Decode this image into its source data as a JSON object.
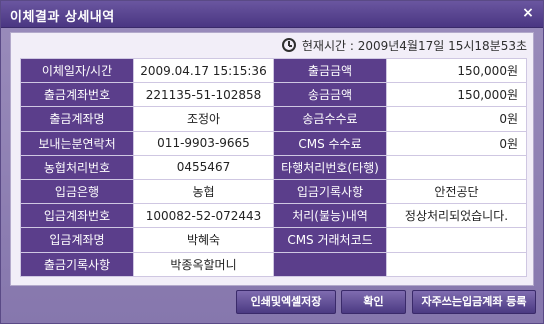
{
  "window": {
    "title": "이체결과 상세내역",
    "close_label": "×"
  },
  "clock": {
    "label": "현재시간 : 2009년4월17일 15시18분53초"
  },
  "table": {
    "rows": [
      {
        "label1": "이체일자/시간",
        "value1": "2009.04.17 15:15:36",
        "label2": "출금금액",
        "value2": "150,000원"
      },
      {
        "label1": "출금계좌번호",
        "value1": "221135-51-102858",
        "label2": "송금금액",
        "value2": "150,000원"
      },
      {
        "label1": "출금계좌명",
        "value1": "조정아",
        "label2": "송금수수료",
        "value2": "0원"
      },
      {
        "label1": "보내는분연락처",
        "value1": "011-9903-9665",
        "label2": "CMS 수수료",
        "value2": "0원"
      },
      {
        "label1": "농협처리번호",
        "value1": "0455467",
        "label2": "타행처리번호(타행)",
        "value2": ""
      },
      {
        "label1": "입금은행",
        "value1": "농협",
        "label2": "입금기록사항",
        "value2": "안전공단"
      },
      {
        "label1": "입금계좌번호",
        "value1": "100082-52-072443",
        "label2": "처리(불능)내역",
        "value2": "정상처리되었습니다."
      },
      {
        "label1": "입금계좌명",
        "value1": "박혜숙",
        "label2": "CMS 거래처코드",
        "value2": ""
      },
      {
        "label1": "출금기록사항",
        "value1": "박종옥할머니",
        "label2": "",
        "value2": ""
      }
    ]
  },
  "buttons": {
    "print_excel": "인쇄및엑셀저장",
    "confirm": "확인",
    "favorite_account": "자주쓰는입금계좌 등록"
  },
  "colors": {
    "title_bg": "#4a3682",
    "label_bg": "#5b3e8b",
    "panel_bg": "#f2eef8",
    "button_bg": "#4b3a82"
  }
}
